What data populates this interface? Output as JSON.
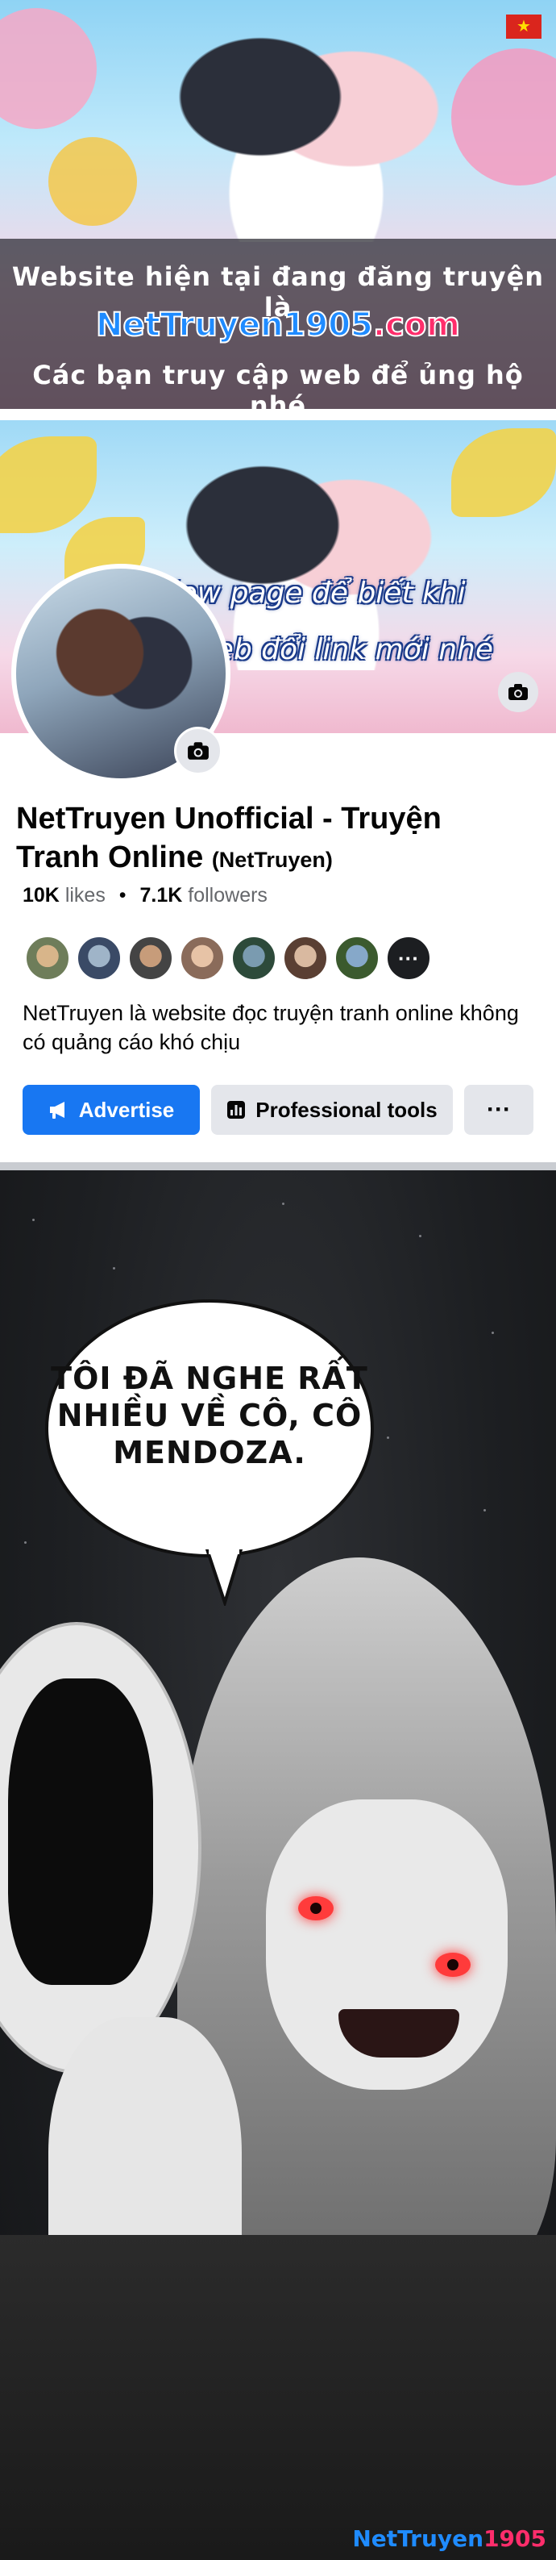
{
  "banner": {
    "line1": "Website hiện tại đang đăng truyện là",
    "domain_part1": "NetTruyen1905",
    "domain_part2": ".com",
    "line3": "Các bạn truy cập web để ủng hộ nhé",
    "flag_symbol": "★"
  },
  "fb_page": {
    "cover_note": "Follow page để biết khi nào web đổi link mới nhé",
    "name": "NetTruyen Unofficial - Truyện Tranh Online",
    "handle": "(NetTruyen)",
    "likes_count": "10K",
    "likes_label": "likes",
    "followers_count": "7.1K",
    "followers_label": "followers",
    "friends_more_label": "···",
    "about": "NetTruyen là website đọc truyện tranh online không có quảng cáo khó chịu",
    "advertise_label": "Advertise",
    "tools_label": "Professional tools",
    "more_label": "···",
    "accent_color": "#1877f2"
  },
  "panel": {
    "speech_bubble": "TÔI ĐÃ NGHE RẤT NHIỀU VỀ CÔ, CÔ MENDOZA.",
    "watermark_part1": "NetTruyen",
    "watermark_part2": "1905"
  }
}
